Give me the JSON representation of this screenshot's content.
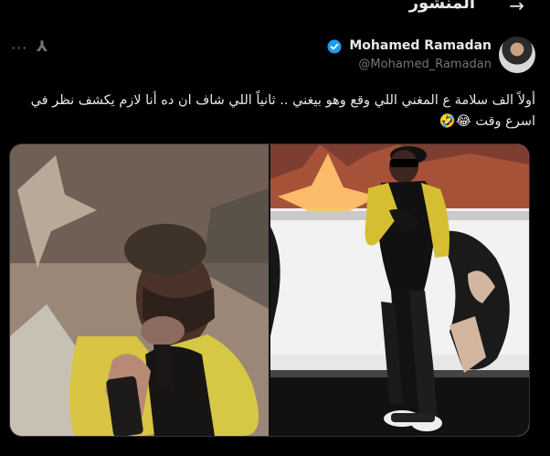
{
  "header": {
    "title": "المنشور",
    "back_icon": "arrow-right-icon"
  },
  "author": {
    "name": "Mohamed Ramadan",
    "handle": "@Mohamed_Ramadan",
    "verified_color": "#1d9bf0"
  },
  "actions": {
    "more_icon": "···",
    "grok_icon": "⅄"
  },
  "post": {
    "text": "أولاً الف سلامة ع المغني اللي وقع وهو بيغني .. ثانياً اللي شاف ان ده أنا لازم يكشف نظر في اسرع وقت 😂🤣"
  },
  "media": {
    "left_icon": "concert-photo-closeup",
    "right_icon": "concert-photo-stage"
  },
  "colors": {
    "background": "#000000",
    "text": "#e7e9ea",
    "muted": "#71767b",
    "border": "#2f3336",
    "accent": "#1d9bf0"
  }
}
